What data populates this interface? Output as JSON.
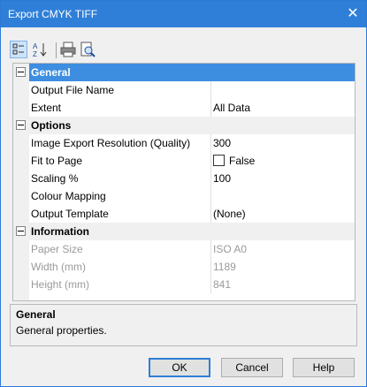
{
  "window": {
    "title": "Export CMYK TIFF",
    "close_glyph": "✕"
  },
  "toolbar": [
    {
      "name": "categorized-icon"
    },
    {
      "name": "sort-az-icon"
    },
    {
      "name": "print-icon"
    },
    {
      "name": "print-preview-icon"
    }
  ],
  "grid": {
    "general": {
      "label": "General",
      "output_file_name": {
        "name": "Output File Name",
        "value": ""
      },
      "extent": {
        "name": "Extent",
        "value": "All Data"
      }
    },
    "options": {
      "label": "Options",
      "resolution": {
        "name": "Image Export Resolution (Quality)",
        "value": "300"
      },
      "fit_to_page": {
        "name": "Fit to Page",
        "value": "False"
      },
      "scaling": {
        "name": "Scaling %",
        "value": "100"
      },
      "colour_mapping": {
        "name": "Colour Mapping",
        "value": ""
      },
      "output_template": {
        "name": "Output Template",
        "value": "(None)"
      }
    },
    "information": {
      "label": "Information",
      "paper_size": {
        "name": "Paper Size",
        "value": "ISO A0"
      },
      "width": {
        "name": "Width (mm)",
        "value": "1189"
      },
      "height": {
        "name": "Height (mm)",
        "value": "841"
      }
    }
  },
  "description": {
    "title": "General",
    "text": "General properties."
  },
  "buttons": {
    "ok": "OK",
    "cancel": "Cancel",
    "help": "Help"
  },
  "colors": {
    "titlebar": "#2f7fd8",
    "selection": "#3d8ee0"
  }
}
